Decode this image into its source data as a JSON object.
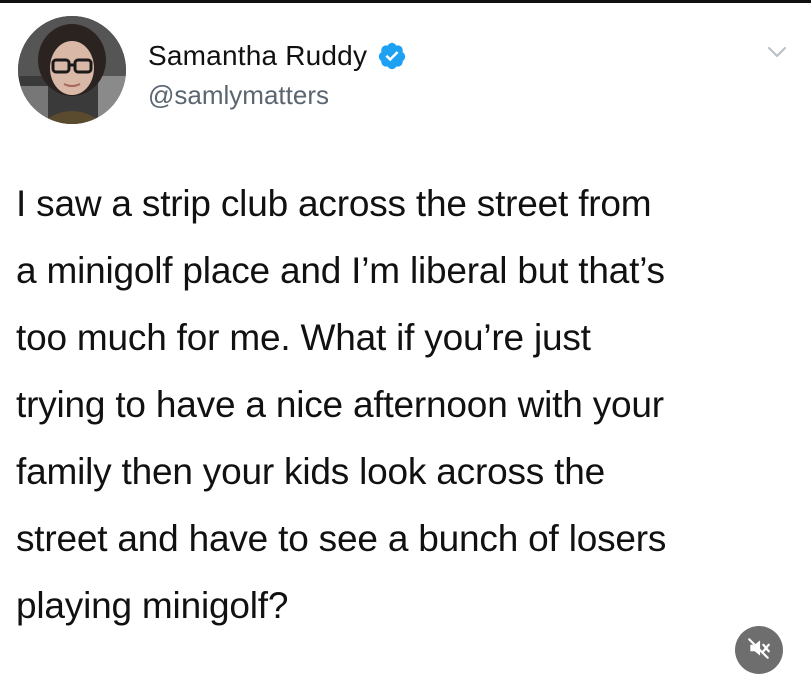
{
  "tweet": {
    "display_name": "Samantha Ruddy",
    "handle": "@samlymatters",
    "verified": true,
    "icons": {
      "verified": "verified-badge-icon",
      "menu": "chevron-down-icon",
      "mute": "muted-speaker-icon"
    },
    "text_lines": [
      "I saw a strip club across the street from",
      "a minigolf place and I’m liberal but that’s",
      "too much for me. What if you’re just",
      "trying to have a nice afternoon with your",
      "family then your kids look across the",
      "street and have to see a bunch of losers",
      "playing minigolf?"
    ]
  },
  "colors": {
    "verified_blue": "#1da1f2",
    "handle_gray": "#5b6670",
    "mute_bg": "#6e6e6e"
  }
}
